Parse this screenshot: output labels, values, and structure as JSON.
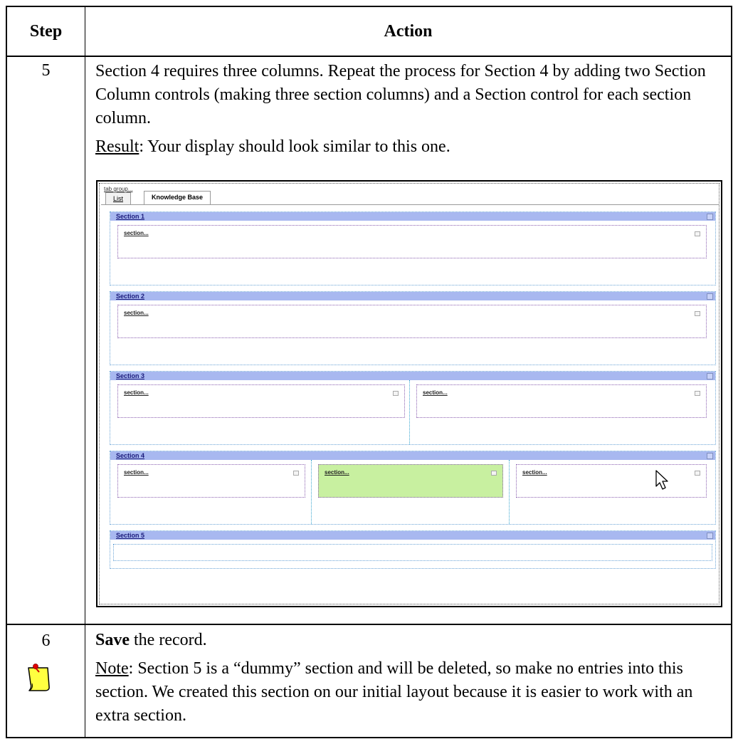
{
  "table": {
    "header_step": "Step",
    "header_action": "Action"
  },
  "row5": {
    "step": "5",
    "paragraph": "Section 4 requires three columns. Repeat the process for Section 4 by adding two Section Column controls (making three section columns) and a Section control for each section column.",
    "result_label": "Result",
    "result_text": ": Your display should look similar to this one."
  },
  "screenshot": {
    "tab_group_label": "tab group...",
    "tabs": [
      "List",
      "Knowledge Base"
    ],
    "sections": [
      {
        "title": "Section 1",
        "columns": [
          "section..."
        ]
      },
      {
        "title": "Section 2",
        "columns": [
          "section..."
        ]
      },
      {
        "title": "Section 3",
        "columns": [
          "section...",
          "section..."
        ]
      },
      {
        "title": "Section 4",
        "columns": [
          "section...",
          "section...",
          "section..."
        ]
      },
      {
        "title": "Section 5",
        "columns": []
      }
    ],
    "highlight_color": "#c8f0a0",
    "section_bar_color": "#a8b8f0"
  },
  "row6": {
    "step": "6",
    "save_bold": "Save",
    "save_rest": " the record.",
    "note_label": "Note",
    "note_text": ": Section 5 is a “dummy” section and will be deleted, so make no entries into this section. We created this section on our initial layout because it is easier to work with an extra section.",
    "note_icon": "sticky-note-icon"
  }
}
